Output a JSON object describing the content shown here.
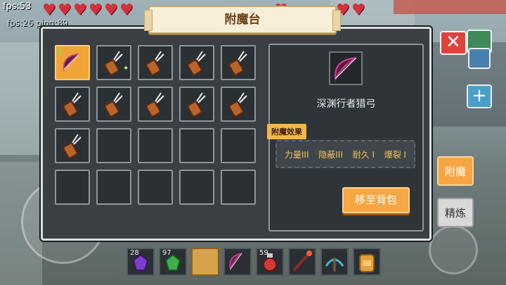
{
  "hud": {
    "fps": "fps:53",
    "net": "fps:26 ping:89",
    "hearts": 10
  },
  "window": {
    "title": "附魔台",
    "close_icon": "close-icon"
  },
  "inventory": {
    "slots": [
      {
        "item": "bow",
        "selected": true,
        "tag": "I"
      },
      {
        "item": "quiver",
        "selected": false,
        "sparkle": true
      },
      {
        "item": "quiver",
        "selected": false
      },
      {
        "item": "quiver",
        "selected": false
      },
      {
        "item": "quiver",
        "selected": false
      },
      {
        "item": "quiver",
        "selected": false
      },
      {
        "item": "quiver",
        "selected": false
      },
      {
        "item": "quiver",
        "selected": false
      },
      {
        "item": "quiver",
        "selected": false
      },
      {
        "item": "quiver",
        "selected": false
      },
      {
        "item": "quiver",
        "selected": false
      },
      {
        "item": "empty"
      },
      {
        "item": "empty"
      },
      {
        "item": "empty"
      },
      {
        "item": "empty"
      },
      {
        "item": "empty"
      },
      {
        "item": "empty"
      },
      {
        "item": "empty"
      },
      {
        "item": "empty"
      },
      {
        "item": "empty"
      }
    ]
  },
  "detail": {
    "item_name": "深渊行者猎弓",
    "enchant_label": "附魔效果",
    "enchantments": [
      "力量III",
      "隐蔽III",
      "耐久 I",
      "爆裂 I"
    ],
    "move_button": "移至背包"
  },
  "tabs": {
    "enchant": "附魔",
    "refine": "精炼"
  },
  "hotbar": [
    {
      "count": "28",
      "item": "purple-gem"
    },
    {
      "count": "97",
      "item": "green-gem"
    },
    {
      "count": "",
      "item": "empty-selected"
    },
    {
      "count": "",
      "item": "bow"
    },
    {
      "count": "59",
      "item": "potion"
    },
    {
      "count": "",
      "item": "staff"
    },
    {
      "count": "",
      "item": "crossbow"
    },
    {
      "count": "",
      "item": "backpack"
    }
  ],
  "colors": {
    "accent": "#f5a642",
    "close": "#e0433c",
    "enchant_text": "#f1c25a"
  }
}
